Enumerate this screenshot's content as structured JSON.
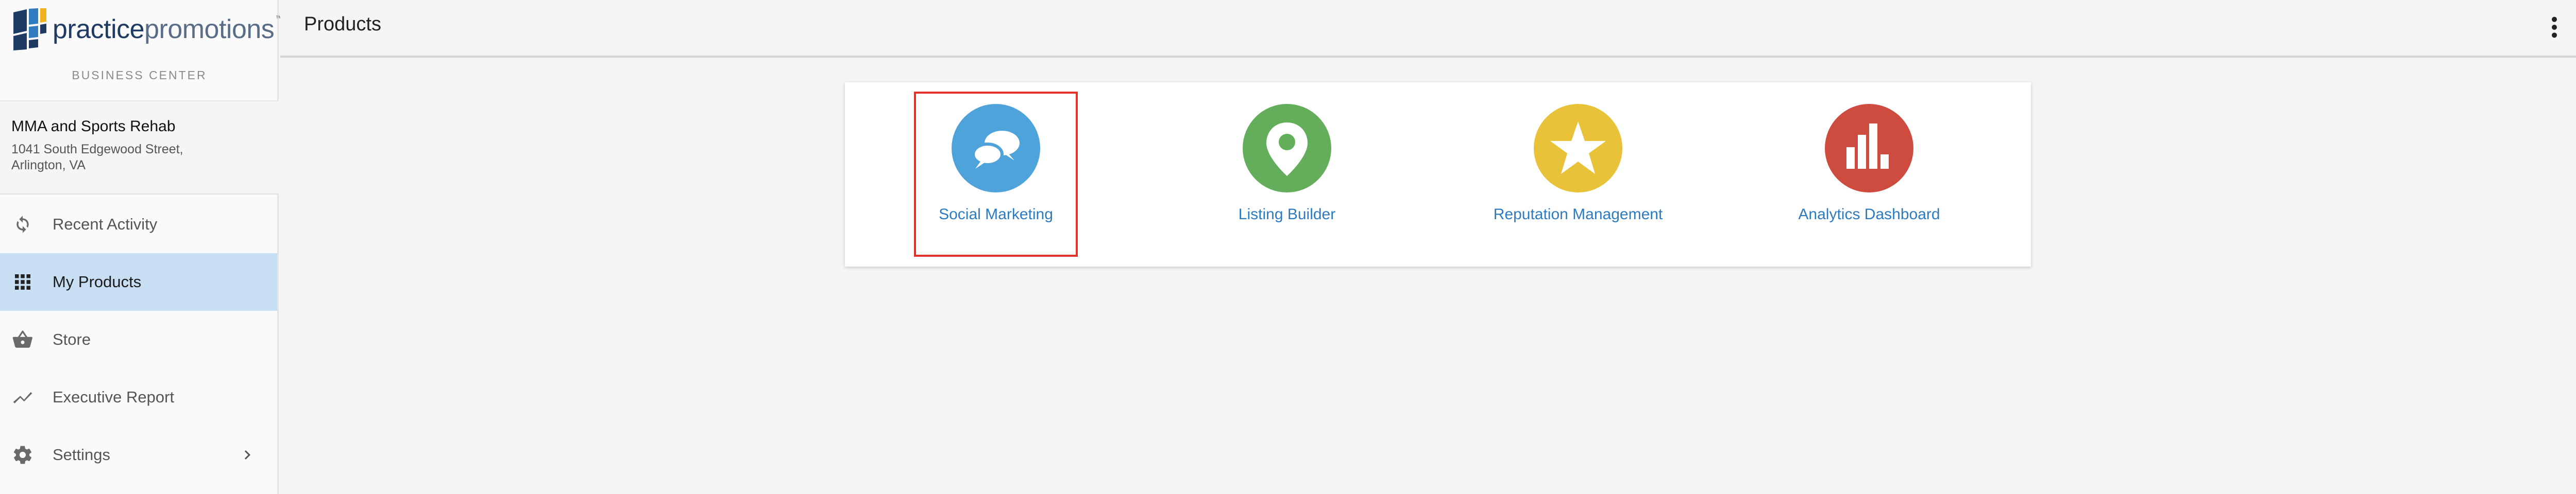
{
  "brand": {
    "logo_text_main": "practice",
    "logo_text_sub": "promotions",
    "logo_tm": "™",
    "center_label": "BUSINESS CENTER"
  },
  "account": {
    "name": "MMA and Sports Rehab",
    "address": "1041 South Edgewood Street, Arlington, VA"
  },
  "sidebar": {
    "items": [
      {
        "label": "Recent Activity",
        "icon": "refresh-icon"
      },
      {
        "label": "My Products",
        "icon": "grid-icon",
        "active": true
      },
      {
        "label": "Store",
        "icon": "basket-icon"
      },
      {
        "label": "Executive Report",
        "icon": "trend-icon"
      },
      {
        "label": "Settings",
        "icon": "gear-icon",
        "has_chevron": true
      }
    ]
  },
  "header": {
    "title": "Products"
  },
  "products": [
    {
      "label": "Social Marketing",
      "icon": "chat-bubbles-icon",
      "color": "#4fa3db",
      "selected": true
    },
    {
      "label": "Listing Builder",
      "icon": "map-pin-icon",
      "color": "#63ad5b"
    },
    {
      "label": "Reputation Management",
      "icon": "star-icon",
      "color": "#e8c33a"
    },
    {
      "label": "Analytics Dashboard",
      "icon": "bar-chart-icon",
      "color": "#cd4b3f"
    }
  ],
  "colors": {
    "active_nav_bg": "#c7def3",
    "link": "#2d7bbf",
    "selection_outline": "#e0312a"
  }
}
